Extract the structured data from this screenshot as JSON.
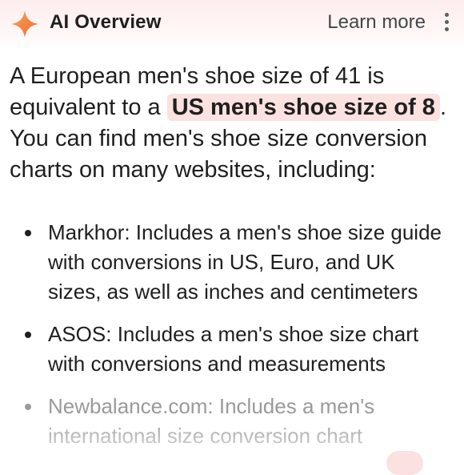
{
  "header": {
    "title": "AI Overview",
    "learn_more": "Learn more",
    "icon": "sparkle-icon",
    "menu_icon": "more-vert-icon",
    "accent": "#f47c46"
  },
  "intro": {
    "part1": "A European men's shoe size of 41 is equivalent to a ",
    "highlight": "US men's shoe size of 8",
    "part2": ". You can find men's shoe size conversion charts on many websites, including:",
    "highlight_color": "#fbe1df"
  },
  "list": {
    "items": [
      "Markhor: Includes a men's shoe size guide with conversions in US, Euro, and UK sizes, as well as inches and centimeters",
      "ASOS: Includes a men's shoe size chart with conversions and measurements",
      "Newbalance.com: Includes a men's international size conversion chart"
    ]
  }
}
